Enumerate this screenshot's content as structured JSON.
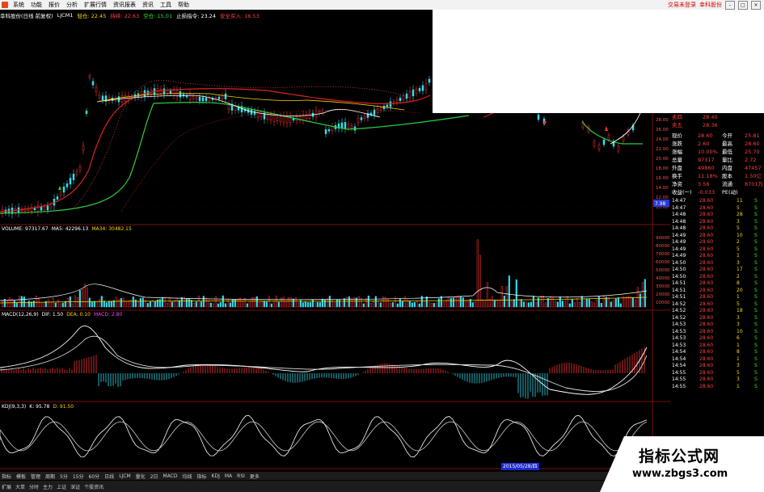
{
  "menu": {
    "items": [
      "系统",
      "功能",
      "报价",
      "分析",
      "扩展行情",
      "资讯报表",
      "资讯",
      "工具",
      "帮助"
    ],
    "right_links": [
      "交易未登录",
      "幸科股份"
    ],
    "window_buttons": [
      "-",
      "□",
      "×"
    ]
  },
  "infobar": {
    "title": "幸科股份(日线 前复权)",
    "indicator": "LJCM1",
    "items": [
      {
        "label": "轻仓: 22.45",
        "color": "y"
      },
      {
        "label": "持续: 22.63",
        "color": "r"
      },
      {
        "label": "空仓: 15.01",
        "color": "g"
      },
      {
        "label": "止损指令: 23.24",
        "color": "w"
      },
      {
        "label": "安全买入: 16.53",
        "color": "r"
      }
    ]
  },
  "volume_label": {
    "name": "VOLUME: 97317.67",
    "ma5": "MA5: 42296.13",
    "ma34": "MA34: 30482.15"
  },
  "macd_label": {
    "name": "MACD(12,26,9)",
    "dif": "DIF: 1.50",
    "dea": "DEA: 0.10",
    "macd": "MACD: 2.80"
  },
  "kdj_label": {
    "name": "KDJ(9,3,3)",
    "k": "K: 95.78",
    "d": "D: 91.50"
  },
  "price_scale": [
    "28.00",
    "26.00",
    "24.00",
    "22.00",
    "20.00",
    "18.00",
    "16.00",
    "14.00",
    "12.00",
    "10.00"
  ],
  "price_tag": "7.98",
  "volume_scale": [
    "90000",
    "80000",
    "70000",
    "60000",
    "50000",
    "40000",
    "30000",
    "20000",
    "10000"
  ],
  "quote": {
    "sell": [
      {
        "label": "卖四",
        "price": "28.40"
      },
      {
        "label": "卖五",
        "price": "28.36"
      }
    ],
    "fields": [
      {
        "k1": "现价",
        "v1": "28.60",
        "k2": "今开",
        "v2": "25.81"
      },
      {
        "k1": "涨跌",
        "v1": "2.60",
        "k2": "最高",
        "v2": "28.60"
      },
      {
        "k1": "涨幅",
        "v1": "10.00%",
        "k2": "最低",
        "v2": "25.70"
      },
      {
        "k1": "总量",
        "v1": "97317",
        "k2": "量比",
        "v2": "2.72"
      },
      {
        "k1": "外盘",
        "v1": "49860",
        "k2": "内盘",
        "v2": "47457"
      },
      {
        "k1": "换手",
        "v1": "11.18%",
        "k2": "股本",
        "v2": "1.50亿"
      },
      {
        "k1": "净资",
        "v1": "3.56",
        "k2": "流通",
        "v2": "8701万"
      },
      {
        "k1": "收益(一)",
        "v1": "-0.033",
        "k2": "PE(动)",
        "v2": ""
      }
    ],
    "ticks": [
      {
        "t": "14:47",
        "p": "28.60",
        "v": "11",
        "s": "S"
      },
      {
        "t": "14:47",
        "p": "28.60",
        "v": "5",
        "s": "S"
      },
      {
        "t": "14:48",
        "p": "28.60",
        "v": "28",
        "s": "S"
      },
      {
        "t": "14:48",
        "p": "28.60",
        "v": "3",
        "s": "S"
      },
      {
        "t": "14:48",
        "p": "28.60",
        "v": "5",
        "s": "S"
      },
      {
        "t": "14:49",
        "p": "28.60",
        "v": "10",
        "s": "S"
      },
      {
        "t": "14:49",
        "p": "28.60",
        "v": "2",
        "s": "S"
      },
      {
        "t": "14:49",
        "p": "28.60",
        "v": "5",
        "s": "S"
      },
      {
        "t": "14:49",
        "p": "28.60",
        "v": "1",
        "s": "S"
      },
      {
        "t": "14:50",
        "p": "28.60",
        "v": "3",
        "s": "S"
      },
      {
        "t": "14:50",
        "p": "28.60",
        "v": "17",
        "s": "S"
      },
      {
        "t": "14:50",
        "p": "28.60",
        "v": "2",
        "s": "S"
      },
      {
        "t": "14:51",
        "p": "28.60",
        "v": "8",
        "s": "S"
      },
      {
        "t": "14:51",
        "p": "28.60",
        "v": "20",
        "s": "S"
      },
      {
        "t": "14:51",
        "p": "28.60",
        "v": "1",
        "s": "S"
      },
      {
        "t": "14:52",
        "p": "28.60",
        "v": "5",
        "s": "S"
      },
      {
        "t": "14:52",
        "p": "28.60",
        "v": "18",
        "s": "S"
      },
      {
        "t": "14:52",
        "p": "28.60",
        "v": "3",
        "s": "S"
      },
      {
        "t": "14:53",
        "p": "28.60",
        "v": "3",
        "s": "S"
      },
      {
        "t": "14:53",
        "p": "28.60",
        "v": "10",
        "s": "S"
      },
      {
        "t": "14:53",
        "p": "28.60",
        "v": "6",
        "s": "S"
      },
      {
        "t": "14:53",
        "p": "28.60",
        "v": "1",
        "s": "S"
      },
      {
        "t": "14:54",
        "p": "28.60",
        "v": "8",
        "s": "S"
      },
      {
        "t": "14:54",
        "p": "28.60",
        "v": "1",
        "s": "S"
      },
      {
        "t": "14:54",
        "p": "28.60",
        "v": "3",
        "s": "S"
      },
      {
        "t": "14:55",
        "p": "28.60",
        "v": "5",
        "s": "S"
      },
      {
        "t": "14:55",
        "p": "28.60",
        "v": "3",
        "s": "S"
      },
      {
        "t": "14:55",
        "p": "28.60",
        "v": "1",
        "s": "S"
      }
    ]
  },
  "tabs": [
    "指标",
    "模板",
    "管理",
    "周期",
    "5分",
    "15分",
    "60分",
    "日线",
    "LJCM",
    "量化",
    "2日",
    "MACD",
    "均线",
    "指标",
    "KDJ",
    "MA",
    "RSI",
    "更多"
  ],
  "status": [
    "扩展",
    "大单",
    "分时",
    "主力",
    "上证",
    "深证",
    "个股资讯"
  ],
  "date_box": "2015/05/28/四",
  "watermark": {
    "title": "指标公式网",
    "url": "www.zbgs3.com"
  },
  "colors": {
    "up": "#ff3333",
    "down": "#33ddee",
    "ma_slow": "#2ecc40",
    "ma_fast": "#ffffff",
    "macd_pos": "#ff3333",
    "macd_neg": "#33ddee"
  }
}
